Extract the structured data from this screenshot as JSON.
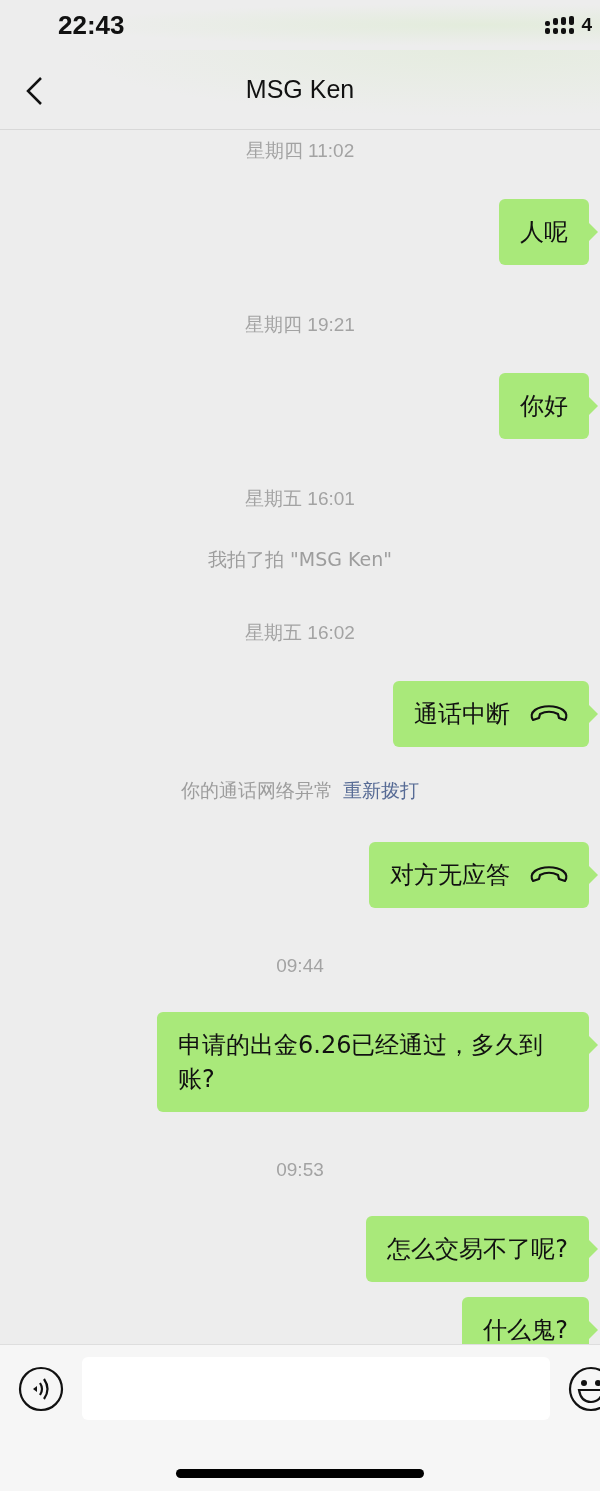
{
  "status_bar": {
    "time": "22:43",
    "network": "4"
  },
  "nav": {
    "title": "MSG Ken"
  },
  "messages": [
    {
      "kind": "time",
      "text": "星期四 11:02"
    },
    {
      "kind": "message",
      "text": "人呢"
    },
    {
      "kind": "time",
      "text": "星期四 19:21"
    },
    {
      "kind": "message",
      "text": "你好"
    },
    {
      "kind": "time",
      "text": "星期五 16:01"
    },
    {
      "kind": "notice",
      "text": "我拍了拍 \"MSG Ken\""
    },
    {
      "kind": "time",
      "text": "星期五 16:02"
    },
    {
      "kind": "call",
      "text": "通话中断"
    },
    {
      "kind": "notice",
      "text": "你的通话网络异常",
      "link": "重新拨打"
    },
    {
      "kind": "call",
      "text": "对方无应答"
    },
    {
      "kind": "time",
      "text": "09:44"
    },
    {
      "kind": "message",
      "text": "申请的出金6.26已经通过，多久到账?"
    },
    {
      "kind": "time",
      "text": "09:53"
    },
    {
      "kind": "message",
      "text": "怎么交易不了呢?"
    },
    {
      "kind": "message",
      "text": "什么鬼?"
    }
  ]
}
